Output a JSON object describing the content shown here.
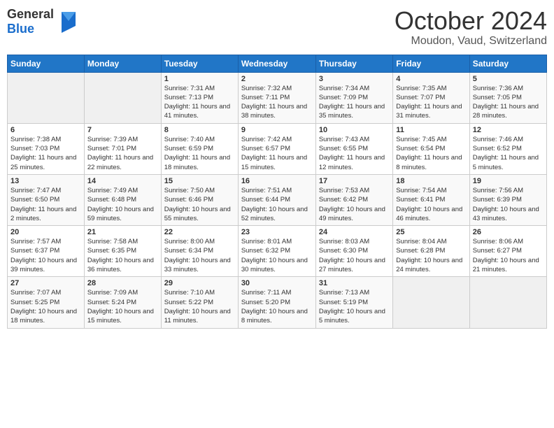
{
  "header": {
    "logo_general": "General",
    "logo_blue": "Blue",
    "month_title": "October 2024",
    "location": "Moudon, Vaud, Switzerland"
  },
  "days_of_week": [
    "Sunday",
    "Monday",
    "Tuesday",
    "Wednesday",
    "Thursday",
    "Friday",
    "Saturday"
  ],
  "weeks": [
    [
      {
        "day": "",
        "info": ""
      },
      {
        "day": "",
        "info": ""
      },
      {
        "day": "1",
        "info": "Sunrise: 7:31 AM\nSunset: 7:13 PM\nDaylight: 11 hours and 41 minutes."
      },
      {
        "day": "2",
        "info": "Sunrise: 7:32 AM\nSunset: 7:11 PM\nDaylight: 11 hours and 38 minutes."
      },
      {
        "day": "3",
        "info": "Sunrise: 7:34 AM\nSunset: 7:09 PM\nDaylight: 11 hours and 35 minutes."
      },
      {
        "day": "4",
        "info": "Sunrise: 7:35 AM\nSunset: 7:07 PM\nDaylight: 11 hours and 31 minutes."
      },
      {
        "day": "5",
        "info": "Sunrise: 7:36 AM\nSunset: 7:05 PM\nDaylight: 11 hours and 28 minutes."
      }
    ],
    [
      {
        "day": "6",
        "info": "Sunrise: 7:38 AM\nSunset: 7:03 PM\nDaylight: 11 hours and 25 minutes."
      },
      {
        "day": "7",
        "info": "Sunrise: 7:39 AM\nSunset: 7:01 PM\nDaylight: 11 hours and 22 minutes."
      },
      {
        "day": "8",
        "info": "Sunrise: 7:40 AM\nSunset: 6:59 PM\nDaylight: 11 hours and 18 minutes."
      },
      {
        "day": "9",
        "info": "Sunrise: 7:42 AM\nSunset: 6:57 PM\nDaylight: 11 hours and 15 minutes."
      },
      {
        "day": "10",
        "info": "Sunrise: 7:43 AM\nSunset: 6:55 PM\nDaylight: 11 hours and 12 minutes."
      },
      {
        "day": "11",
        "info": "Sunrise: 7:45 AM\nSunset: 6:54 PM\nDaylight: 11 hours and 8 minutes."
      },
      {
        "day": "12",
        "info": "Sunrise: 7:46 AM\nSunset: 6:52 PM\nDaylight: 11 hours and 5 minutes."
      }
    ],
    [
      {
        "day": "13",
        "info": "Sunrise: 7:47 AM\nSunset: 6:50 PM\nDaylight: 11 hours and 2 minutes."
      },
      {
        "day": "14",
        "info": "Sunrise: 7:49 AM\nSunset: 6:48 PM\nDaylight: 10 hours and 59 minutes."
      },
      {
        "day": "15",
        "info": "Sunrise: 7:50 AM\nSunset: 6:46 PM\nDaylight: 10 hours and 55 minutes."
      },
      {
        "day": "16",
        "info": "Sunrise: 7:51 AM\nSunset: 6:44 PM\nDaylight: 10 hours and 52 minutes."
      },
      {
        "day": "17",
        "info": "Sunrise: 7:53 AM\nSunset: 6:42 PM\nDaylight: 10 hours and 49 minutes."
      },
      {
        "day": "18",
        "info": "Sunrise: 7:54 AM\nSunset: 6:41 PM\nDaylight: 10 hours and 46 minutes."
      },
      {
        "day": "19",
        "info": "Sunrise: 7:56 AM\nSunset: 6:39 PM\nDaylight: 10 hours and 43 minutes."
      }
    ],
    [
      {
        "day": "20",
        "info": "Sunrise: 7:57 AM\nSunset: 6:37 PM\nDaylight: 10 hours and 39 minutes."
      },
      {
        "day": "21",
        "info": "Sunrise: 7:58 AM\nSunset: 6:35 PM\nDaylight: 10 hours and 36 minutes."
      },
      {
        "day": "22",
        "info": "Sunrise: 8:00 AM\nSunset: 6:34 PM\nDaylight: 10 hours and 33 minutes."
      },
      {
        "day": "23",
        "info": "Sunrise: 8:01 AM\nSunset: 6:32 PM\nDaylight: 10 hours and 30 minutes."
      },
      {
        "day": "24",
        "info": "Sunrise: 8:03 AM\nSunset: 6:30 PM\nDaylight: 10 hours and 27 minutes."
      },
      {
        "day": "25",
        "info": "Sunrise: 8:04 AM\nSunset: 6:28 PM\nDaylight: 10 hours and 24 minutes."
      },
      {
        "day": "26",
        "info": "Sunrise: 8:06 AM\nSunset: 6:27 PM\nDaylight: 10 hours and 21 minutes."
      }
    ],
    [
      {
        "day": "27",
        "info": "Sunrise: 7:07 AM\nSunset: 5:25 PM\nDaylight: 10 hours and 18 minutes."
      },
      {
        "day": "28",
        "info": "Sunrise: 7:09 AM\nSunset: 5:24 PM\nDaylight: 10 hours and 15 minutes."
      },
      {
        "day": "29",
        "info": "Sunrise: 7:10 AM\nSunset: 5:22 PM\nDaylight: 10 hours and 11 minutes."
      },
      {
        "day": "30",
        "info": "Sunrise: 7:11 AM\nSunset: 5:20 PM\nDaylight: 10 hours and 8 minutes."
      },
      {
        "day": "31",
        "info": "Sunrise: 7:13 AM\nSunset: 5:19 PM\nDaylight: 10 hours and 5 minutes."
      },
      {
        "day": "",
        "info": ""
      },
      {
        "day": "",
        "info": ""
      }
    ]
  ]
}
